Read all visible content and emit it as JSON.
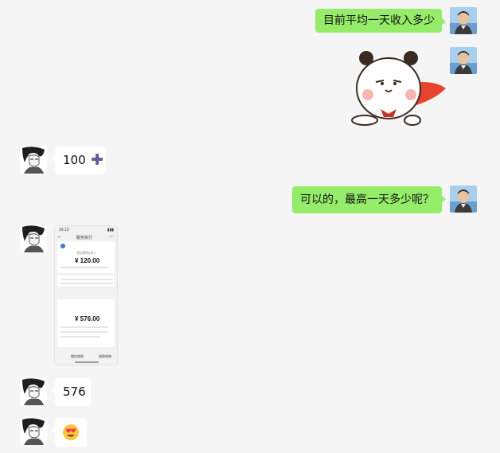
{
  "messages": [
    {
      "sender": "me",
      "type": "text",
      "text": "目前平均一天收入多少"
    },
    {
      "sender": "me",
      "type": "sticker",
      "sticker": "bear-superhero-sticker"
    },
    {
      "sender": "other",
      "type": "text",
      "text": "100",
      "trailing_icon": "plus-icon"
    },
    {
      "sender": "me",
      "type": "text",
      "text": "可以的，最高一天多少呢？"
    },
    {
      "sender": "other",
      "type": "image",
      "image": {
        "status_time": "19:13",
        "page_title": "服务执行",
        "card1_caption": "钱包零钱/收入",
        "amount_1": "¥ 120.00",
        "amount_2": "¥ 576.00",
        "footer_left": "微信收款",
        "footer_right": "收款账单"
      }
    },
    {
      "sender": "other",
      "type": "text",
      "text": "576"
    },
    {
      "sender": "other",
      "type": "emoji",
      "emoji": "🥰"
    }
  ],
  "colors": {
    "background": "#f5f5f5",
    "my_bubble": "#95ec69",
    "other_bubble": "#ffffff",
    "plus_icon": "#6c5c9e"
  }
}
